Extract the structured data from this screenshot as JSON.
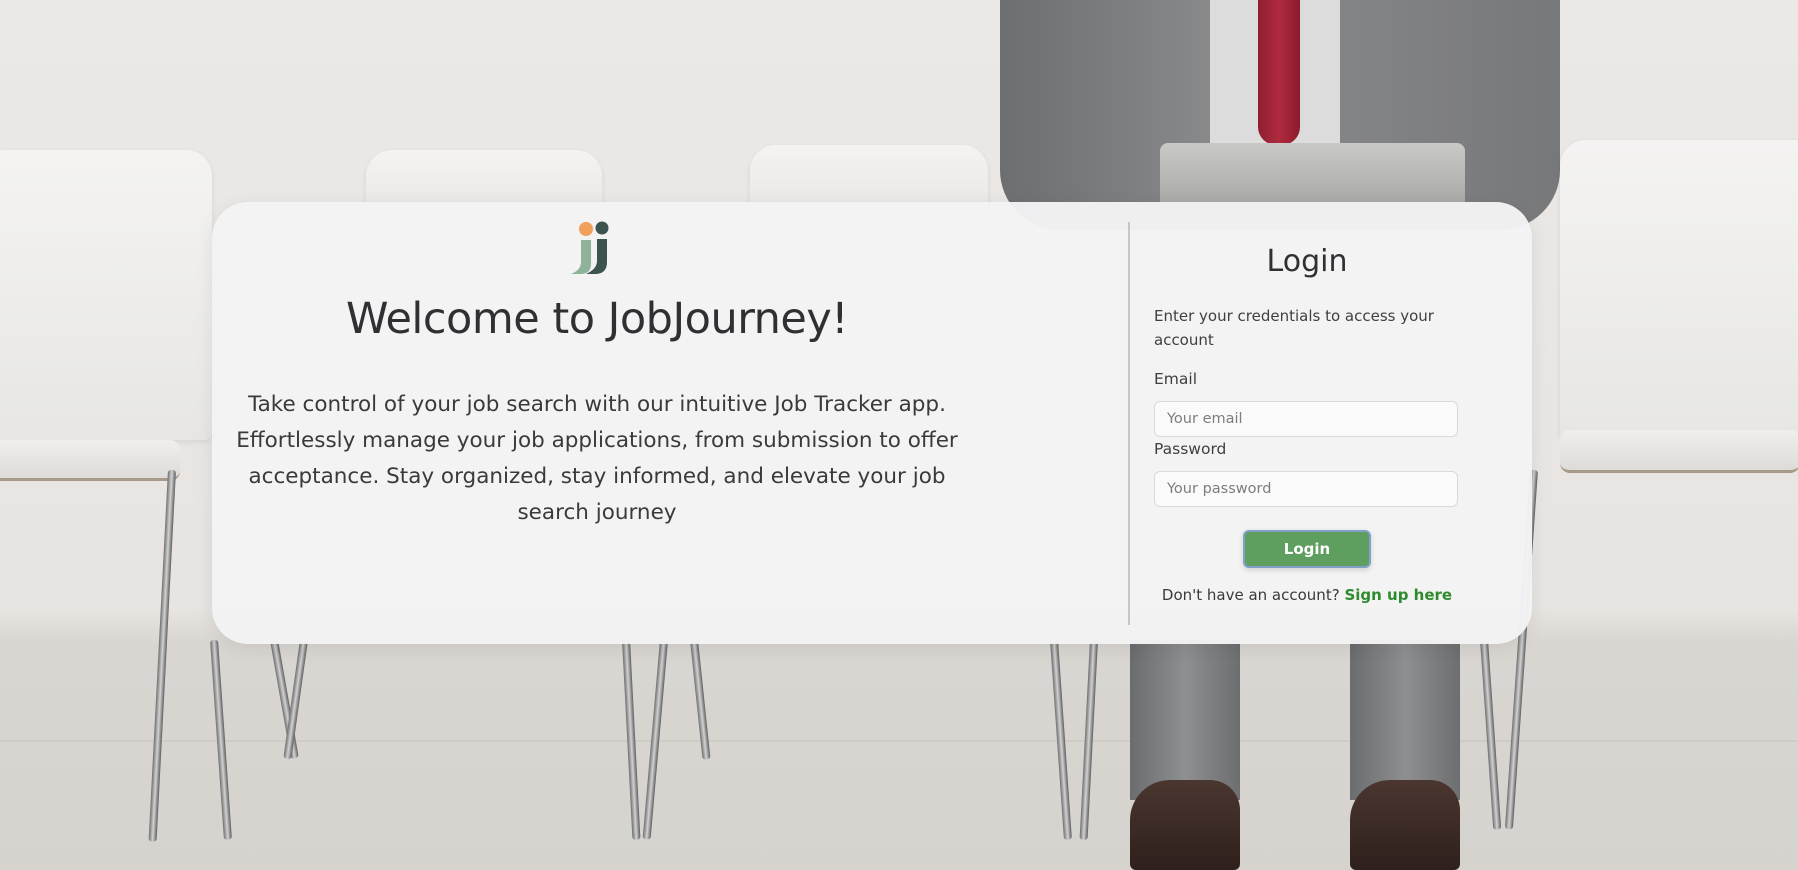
{
  "hero": {
    "title": "Welcome to JobJourney!",
    "description": "Take control of your job search with our intuitive Job Tracker app. Effortlessly manage your job applications, from submission to offer acceptance. Stay organized, stay informed, and elevate your job search journey",
    "logo_icon": "jobjourney-logo-icon"
  },
  "login": {
    "title": "Login",
    "subtitle": "Enter your credentials to access your account",
    "email_label": "Email",
    "email_placeholder": "Your email",
    "email_value": "",
    "password_label": "Password",
    "password_placeholder": "Your password",
    "password_value": "",
    "button_label": "Login",
    "signup_prompt": "Don't have an account?",
    "signup_link": "Sign up here"
  },
  "colors": {
    "button_green": "#5e9e5e",
    "link_green": "#2e8b2e",
    "logo_orange": "#f0a05a",
    "logo_dark": "#3d5350",
    "logo_sage": "#8fb39a"
  }
}
